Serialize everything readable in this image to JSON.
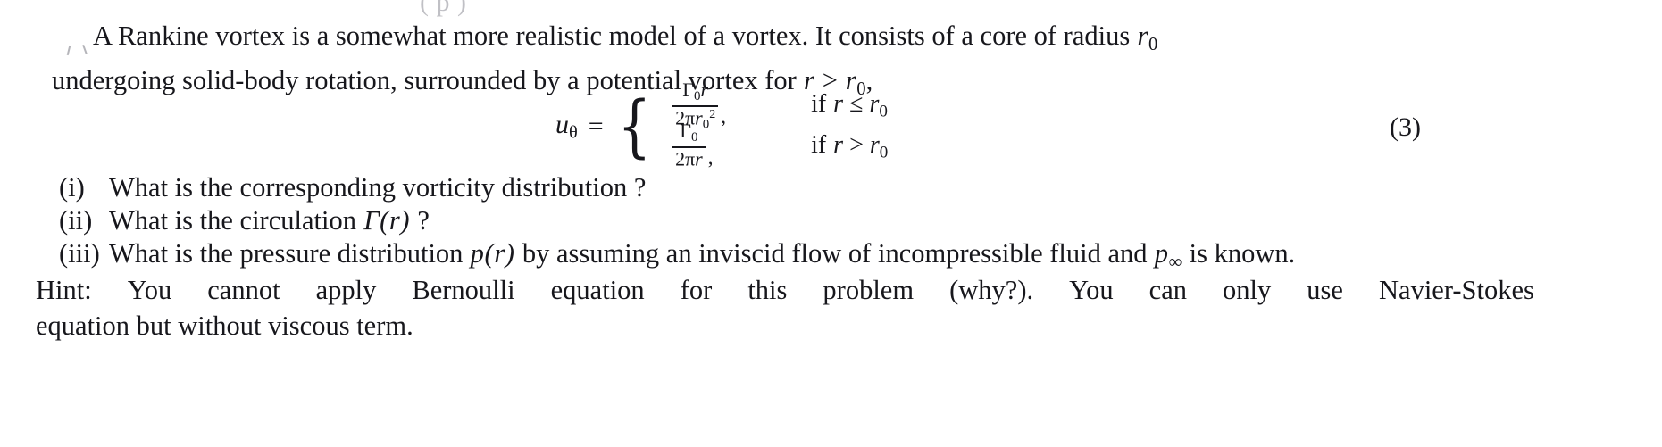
{
  "document": {
    "clipped_top_fragment": "(     p     )",
    "paragraph_intro": {
      "line1": "A Rankine vortex is a somewhat more realistic model of a vortex. It consists of a core of radius",
      "line1_math": "r0",
      "line2_a": "undergoing solid-body rotation, surrounded by a potential vortex for",
      "line2_math": "r > r0",
      "line2_b": ","
    },
    "equation": {
      "number": "(3)",
      "lhs_symbol": "u",
      "lhs_subscript": "θ",
      "equals": "=",
      "brace": "{",
      "cases": [
        {
          "numerator_gamma": "Γ",
          "numerator_gamma_sub": "0",
          "numerator_var": "r",
          "denominator_coeff": "2π",
          "denominator_var": "r",
          "denominator_sub": "0",
          "denominator_sup": "2",
          "comma": ",",
          "condition_if": "if",
          "condition_var": "r",
          "condition_rel": "≤",
          "condition_bound": "r",
          "condition_bound_sub": "0"
        },
        {
          "numerator_gamma": "Γ",
          "numerator_gamma_sub": "0",
          "numerator_var": "",
          "denominator_coeff": "2π",
          "denominator_var": "r",
          "denominator_sub": "",
          "denominator_sup": "",
          "comma": ",",
          "condition_if": "if",
          "condition_var": "r",
          "condition_rel": ">",
          "condition_bound": "r",
          "condition_bound_sub": "0"
        }
      ]
    },
    "questions": [
      {
        "marker": "(i)",
        "text_before": "What is the corresponding vorticity distribution ?",
        "math": "",
        "text_after": ""
      },
      {
        "marker": "(ii)",
        "text_before": "What is the circulation",
        "math": "Γ(r)",
        "text_after": "?"
      },
      {
        "marker": "(iii)",
        "text_before": "What is the pressure distribution",
        "math": "p(r)",
        "text_mid": "by assuming an inviscid flow of incompressible fluid and",
        "math2": "p∞",
        "text_after": "is known."
      }
    ],
    "hint": {
      "line1": "Hint: You cannot apply Bernoulli equation for this problem (why?). You can only use Navier-Stokes",
      "line2": "equation but without viscous term."
    }
  },
  "colors": {
    "page_background": "#ffffff",
    "text": "#17171c",
    "faint_scan_artifact": "#8e8e96"
  }
}
